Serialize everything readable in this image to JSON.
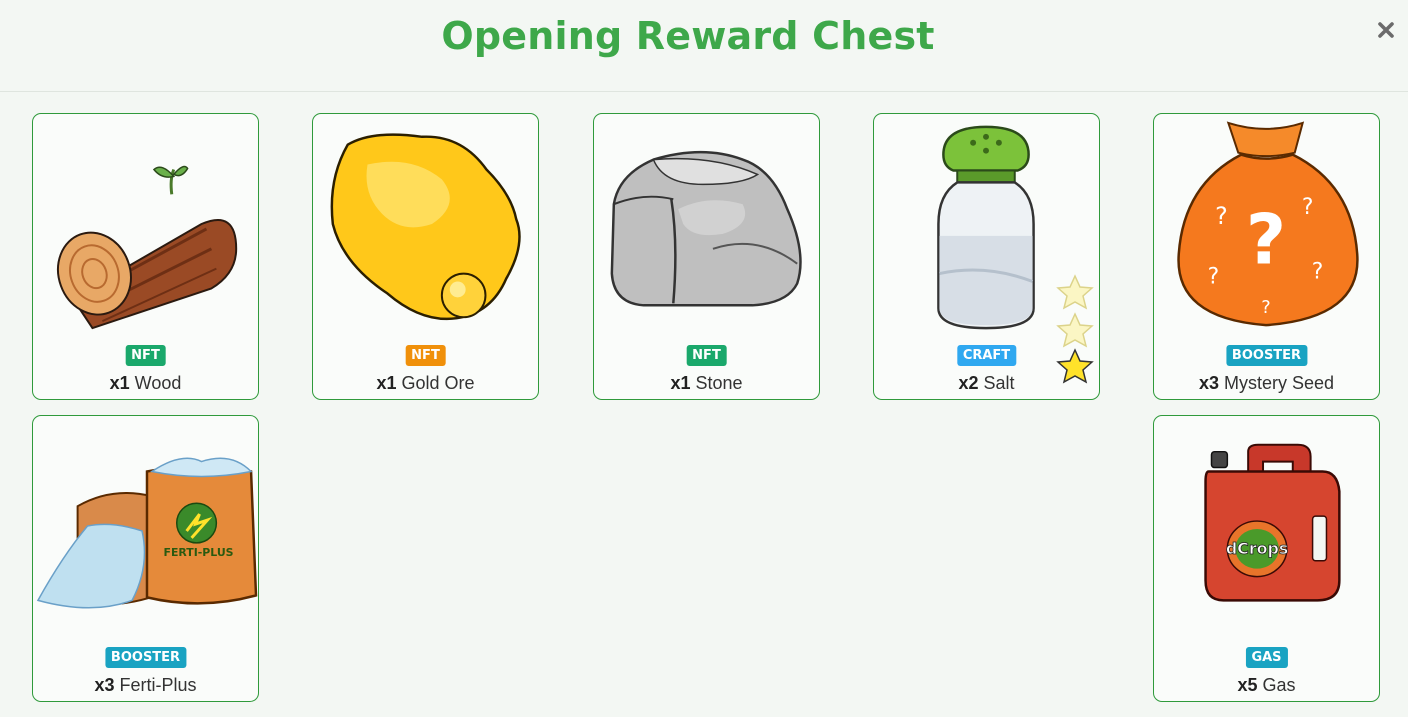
{
  "header": {
    "title": "Opening Reward Chest",
    "close_icon": "close-icon"
  },
  "colors": {
    "title": "#3ea84a",
    "card_border": "#2f9a3b",
    "badge_nft_green": "#1aa86b",
    "badge_nft_orange": "#f0900a",
    "badge_craft": "#2fa8f0",
    "badge_booster": "#19a3c2",
    "badge_gas": "#19a3c2"
  },
  "rewards": [
    {
      "badge": "NFT",
      "badge_color": "#1aa86b",
      "qty": "x1",
      "name": "Wood",
      "icon": "wood-log-icon"
    },
    {
      "badge": "NFT",
      "badge_color": "#f0900a",
      "qty": "x1",
      "name": "Gold Ore",
      "icon": "gold-ore-icon"
    },
    {
      "badge": "NFT",
      "badge_color": "#1aa86b",
      "qty": "x1",
      "name": "Stone",
      "icon": "stone-icon"
    },
    {
      "badge": "CRAFT",
      "badge_color": "#2fa8f0",
      "qty": "x2",
      "name": "Salt",
      "icon": "salt-shaker-icon",
      "stars": 1,
      "stars_max": 3
    },
    {
      "badge": "BOOSTER",
      "badge_color": "#19a3c2",
      "qty": "x3",
      "name": "Mystery Seed",
      "icon": "mystery-seed-bag-icon"
    },
    {
      "badge": "BOOSTER",
      "badge_color": "#19a3c2",
      "qty": "x3",
      "name": "Ferti-Plus",
      "icon": "fertilizer-bag-icon",
      "bag_label": "FERTI-PLUS"
    },
    {
      "badge": "GAS",
      "badge_color": "#19a3c2",
      "qty": "x5",
      "name": "Gas",
      "icon": "gas-can-icon",
      "can_label": "dCrops"
    }
  ]
}
